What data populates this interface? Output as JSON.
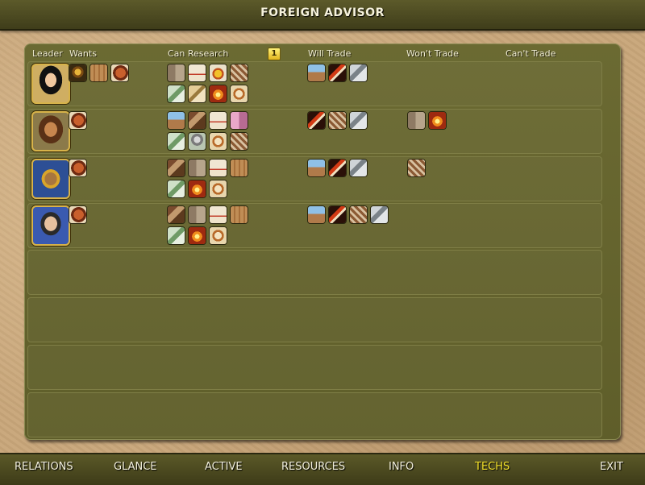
{
  "title": "FOREIGN ADVISOR",
  "headers": {
    "leader": "Leader",
    "wants": "Wants",
    "can_research": "Can Research",
    "will_trade": "Will Trade",
    "wont_trade": "Won't Trade",
    "cant_trade": "Can't Trade"
  },
  "turn_icon": "1",
  "colors": {
    "active_tab": "#f3e12a",
    "panel": "#6b6a32",
    "titlebar": "#4a4820"
  },
  "rows": [
    {
      "leader_portrait": "leader-portrait-woman",
      "wants": [
        "tech-icon-oil-lamp",
        "tech-icon-scroll",
        "tech-icon-shield"
      ],
      "can_research": [
        "tech-icon-tablet",
        "tech-icon-parchment",
        "tech-icon-crown",
        "tech-icon-map",
        "tech-icon-money",
        "tech-icon-harp",
        "tech-icon-fire",
        "tech-icon-compass"
      ],
      "will_trade": [
        "tech-icon-pyramid",
        "tech-icon-sword",
        "tech-icon-wheel"
      ],
      "wont_trade": []
    },
    {
      "leader_portrait": "leader-portrait-bearded-man",
      "wants": [
        "tech-icon-shield"
      ],
      "can_research": [
        "tech-icon-pyramid",
        "tech-icon-mask",
        "tech-icon-parchment",
        "tech-icon-pink-scroll",
        "tech-icon-money",
        "tech-icon-statue",
        "tech-icon-compass",
        "tech-icon-map"
      ],
      "will_trade": [
        "tech-icon-sword",
        "tech-icon-map",
        "tech-icon-wheel"
      ],
      "wont_trade": [
        "tech-icon-tablet",
        "tech-icon-fire"
      ]
    },
    {
      "leader_portrait": "leader-portrait-chief",
      "wants": [
        "tech-icon-shield"
      ],
      "can_research": [
        "tech-icon-mask",
        "tech-icon-tablet",
        "tech-icon-parchment",
        "tech-icon-scroll",
        "tech-icon-money",
        "tech-icon-fire",
        "tech-icon-compass"
      ],
      "will_trade": [
        "tech-icon-pyramid",
        "tech-icon-sword",
        "tech-icon-wheel"
      ],
      "wont_trade": [
        "tech-icon-map"
      ]
    },
    {
      "leader_portrait": "leader-portrait-emperor",
      "wants": [
        "tech-icon-shield"
      ],
      "can_research": [
        "tech-icon-mask",
        "tech-icon-tablet",
        "tech-icon-parchment",
        "tech-icon-scroll",
        "tech-icon-money",
        "tech-icon-fire",
        "tech-icon-compass"
      ],
      "will_trade": [
        "tech-icon-pyramid",
        "tech-icon-sword",
        "tech-icon-map",
        "tech-icon-wheel"
      ],
      "wont_trade": []
    }
  ],
  "tabs": [
    "RELATIONS",
    "GLANCE",
    "ACTIVE",
    "RESOURCES",
    "INFO",
    "TECHS",
    "EXIT"
  ],
  "active_tab": "TECHS"
}
